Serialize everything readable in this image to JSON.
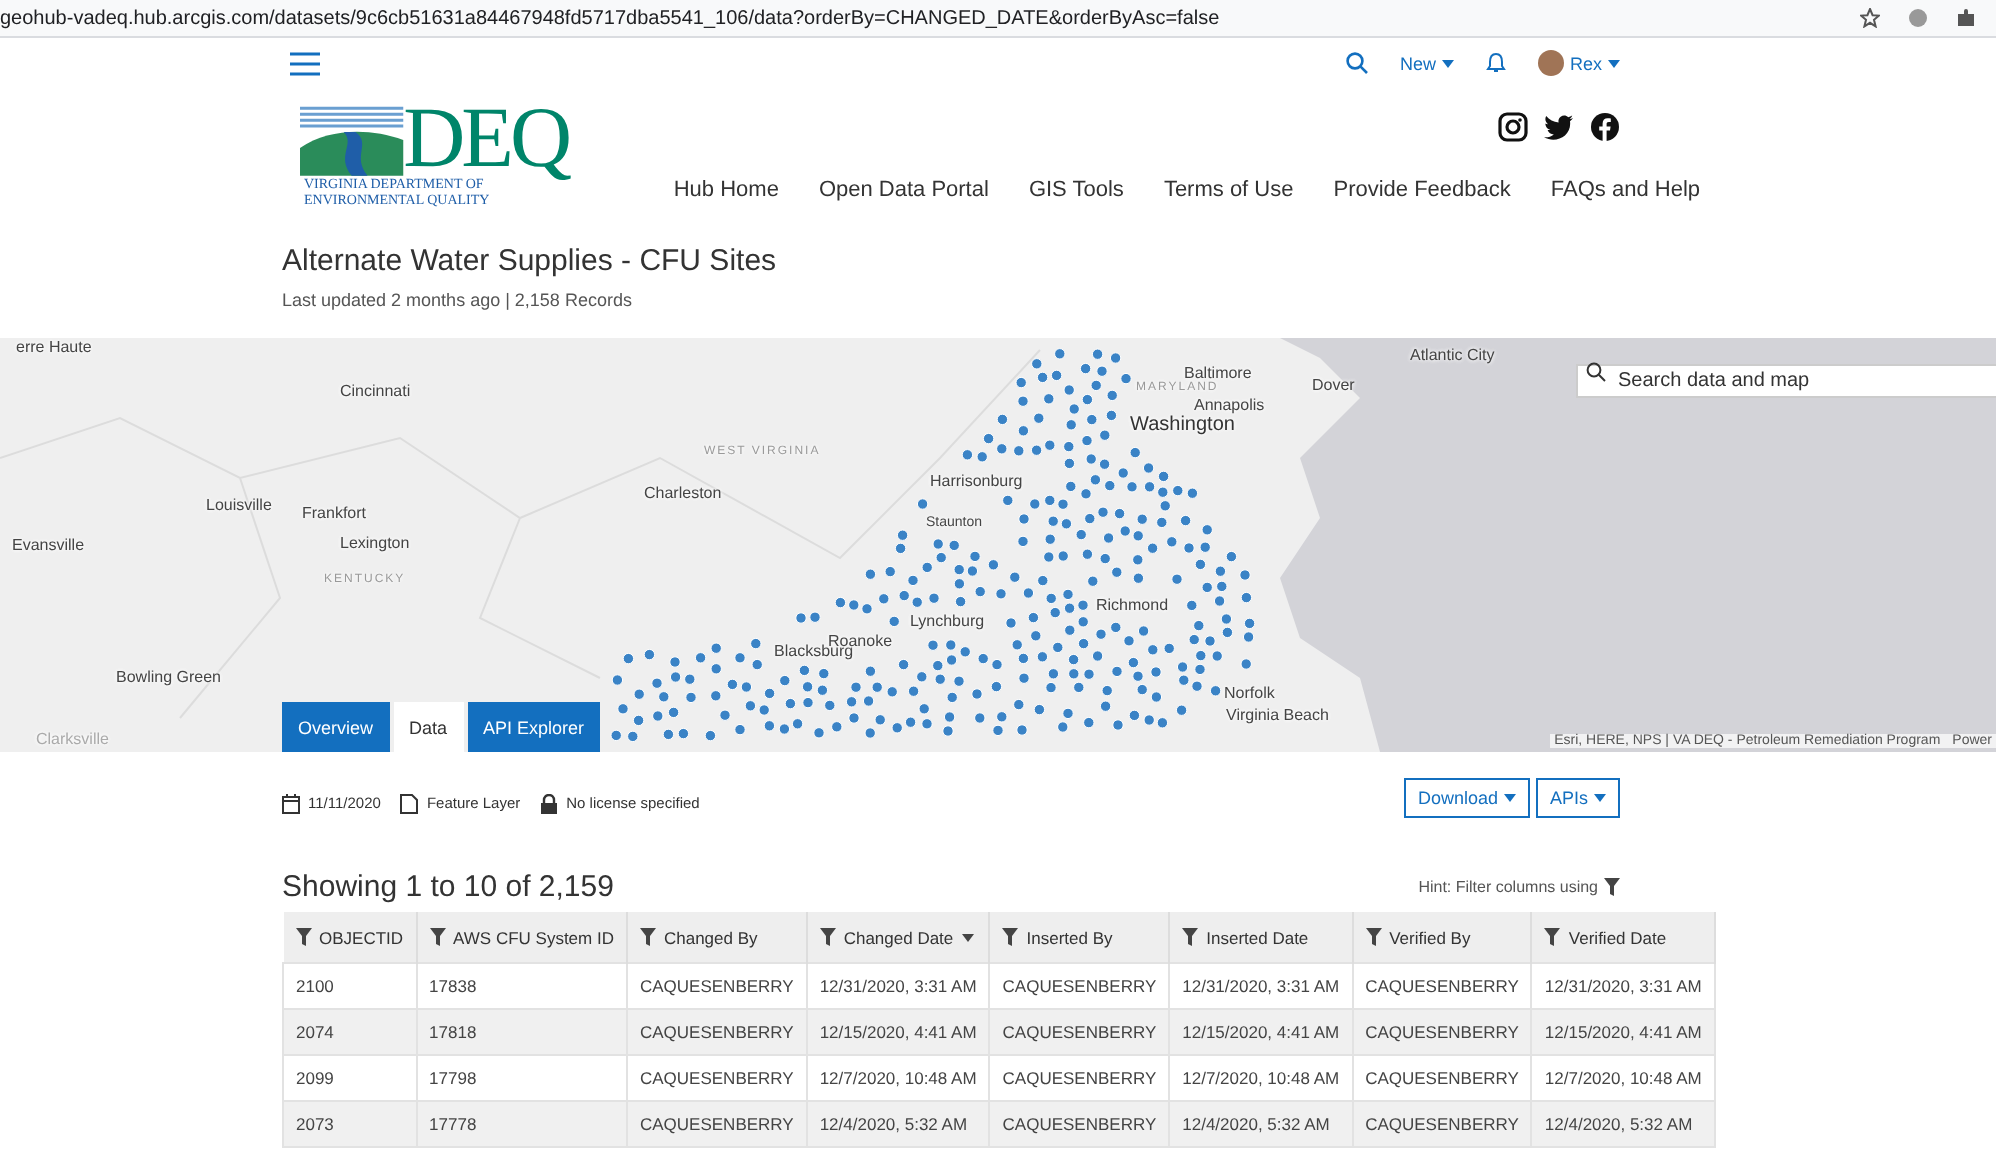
{
  "browser": {
    "url": "geohub-vadeq.hub.arcgis.com/datasets/9c6cb51631a84467948fd5717dba5541_106/data?orderBy=CHANGED_DATE&orderByAsc=false"
  },
  "topbar": {
    "new_label": "New",
    "user": "Rex"
  },
  "logo": {
    "letters": "DEQ",
    "lines": [
      "VIRGINIA DEPARTMENT OF",
      "ENVIRONMENTAL QUALITY"
    ]
  },
  "nav": [
    "Hub Home",
    "Open Data Portal",
    "GIS Tools",
    "Terms of Use",
    "Provide Feedback",
    "FAQs and Help"
  ],
  "dataset": {
    "title": "Alternate Water Supplies - CFU Sites",
    "subtitle": "Last updated 2 months ago | 2,158 Records"
  },
  "map": {
    "labels": [
      {
        "text": "erre Haute",
        "kind": "city"
      },
      {
        "text": "Cincinnati",
        "kind": "city"
      },
      {
        "text": "Baltimore",
        "kind": "city"
      },
      {
        "text": "Dover",
        "kind": "city"
      },
      {
        "text": "Atlantic City",
        "kind": "city"
      },
      {
        "text": "MARYLAND",
        "kind": "state"
      },
      {
        "text": "Annapolis",
        "kind": "city"
      },
      {
        "text": "Washington",
        "kind": "major"
      },
      {
        "text": "WEST VIRGINIA",
        "kind": "state"
      },
      {
        "text": "Charleston",
        "kind": "city"
      },
      {
        "text": "Harrisonburg",
        "kind": "city"
      },
      {
        "text": "Louisville",
        "kind": "city"
      },
      {
        "text": "Frankfort",
        "kind": "city"
      },
      {
        "text": "Lexington",
        "kind": "city"
      },
      {
        "text": "Evansville",
        "kind": "city"
      },
      {
        "text": "KENTUCKY",
        "kind": "state"
      },
      {
        "text": "Staunton",
        "kind": "small"
      },
      {
        "text": "Richmond",
        "kind": "city"
      },
      {
        "text": "Lynchburg",
        "kind": "city"
      },
      {
        "text": "Blacksburg",
        "kind": "city"
      },
      {
        "text": "Roanoke",
        "kind": "city"
      },
      {
        "text": "Bowling Green",
        "kind": "city"
      },
      {
        "text": "Norfolk",
        "kind": "city"
      },
      {
        "text": "Virginia Beach",
        "kind": "city"
      },
      {
        "text": "Clarksville",
        "kind": "faint"
      }
    ],
    "search": {
      "placeholder": "Search data and map"
    },
    "attribution": "Esri, HERE, NPS | VA DEQ - Petroleum Remediation Program",
    "attribution_cut": "Power"
  },
  "tabs": [
    {
      "label": "Overview",
      "selected": false
    },
    {
      "label": "Data",
      "selected": true
    },
    {
      "label": "API Explorer",
      "selected": false
    }
  ],
  "meta": [
    {
      "kind": "date",
      "text": "11/11/2020"
    },
    {
      "kind": "layer",
      "text": "Feature Layer"
    },
    {
      "kind": "license",
      "text": "No license specified"
    }
  ],
  "actions": [
    "Download",
    "APIs"
  ],
  "table": {
    "showing": "Showing 1 to 10 of 2,159",
    "hint": "Hint: Filter columns using",
    "columns": [
      {
        "label": "OBJECTID",
        "sorted": false
      },
      {
        "label": "AWS CFU System ID",
        "sorted": false
      },
      {
        "label": "Changed By",
        "sorted": false
      },
      {
        "label": "Changed Date",
        "sorted": true
      },
      {
        "label": "Inserted By",
        "sorted": false
      },
      {
        "label": "Inserted Date",
        "sorted": false
      },
      {
        "label": "Verified By",
        "sorted": false
      },
      {
        "label": "Verified Date",
        "sorted": false
      }
    ],
    "rows": [
      [
        "2100",
        "17838",
        "CAQUESENBERRY",
        "12/31/2020, 3:31 AM",
        "CAQUESENBERRY",
        "12/31/2020, 3:31 AM",
        "CAQUESENBERRY",
        "12/31/2020, 3:31 AM"
      ],
      [
        "2074",
        "17818",
        "CAQUESENBERRY",
        "12/15/2020, 4:41 AM",
        "CAQUESENBERRY",
        "12/15/2020, 4:41 AM",
        "CAQUESENBERRY",
        "12/15/2020, 4:41 AM"
      ],
      [
        "2099",
        "17798",
        "CAQUESENBERRY",
        "12/7/2020, 10:48 AM",
        "CAQUESENBERRY",
        "12/7/2020, 10:48 AM",
        "CAQUESENBERRY",
        "12/7/2020, 10:48 AM"
      ],
      [
        "2073",
        "17778",
        "CAQUESENBERRY",
        "12/4/2020, 5:32 AM",
        "CAQUESENBERRY",
        "12/4/2020, 5:32 AM",
        "CAQUESENBERRY",
        "12/4/2020, 5:32 AM"
      ]
    ]
  }
}
